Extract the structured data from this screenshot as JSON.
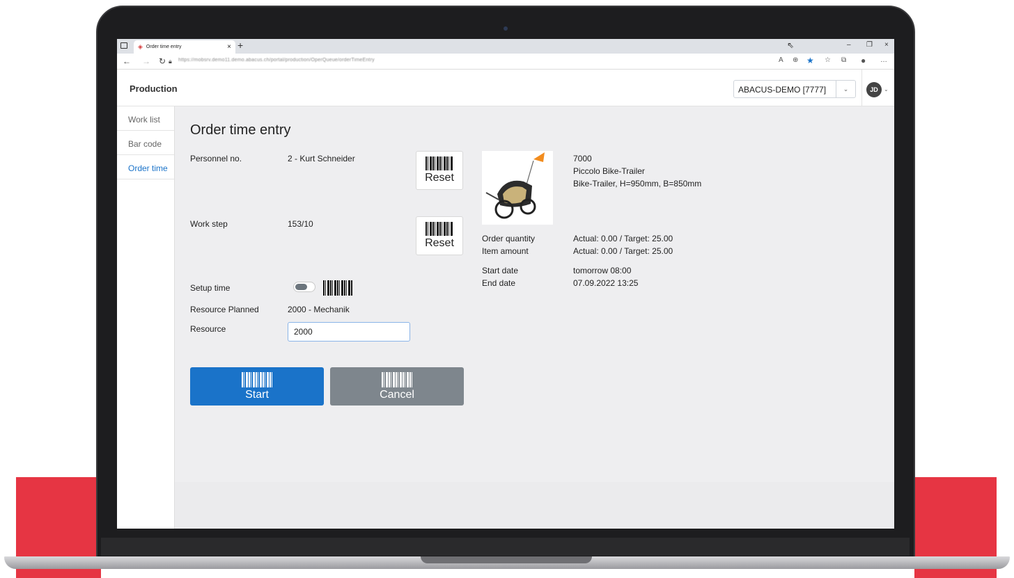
{
  "browser": {
    "tab_title": "Order time entry",
    "tab_close": "×",
    "new_tab": "+",
    "url": "https://mobsrv.demo11.demo.abacus.ch/portal/production/OperQueue/orderTimeEntry",
    "window_controls": {
      "minimize": "–",
      "restore": "❐",
      "close": "×"
    }
  },
  "app": {
    "title": "Production",
    "tenant_selector": "ABACUS-DEMO [7777]",
    "avatar_initials": "JD"
  },
  "sidebar": {
    "items": [
      {
        "label": "Work list"
      },
      {
        "label": "Bar code"
      },
      {
        "label": "Order time"
      }
    ]
  },
  "form": {
    "title": "Order time entry",
    "personnel": {
      "label": "Personnel no.",
      "value": "2 - Kurt Schneider"
    },
    "work_step": {
      "label": "Work step",
      "value": "153/10"
    },
    "reset_label": "Reset",
    "setup_time": {
      "label": "Setup time",
      "enabled": false
    },
    "resource_planned": {
      "label": "Resource Planned",
      "value": "2000 - Mechanik"
    },
    "resource": {
      "label": "Resource",
      "value": "2000"
    },
    "start_label": "Start",
    "cancel_label": "Cancel"
  },
  "item": {
    "number": "7000",
    "name": "Piccolo Bike-Trailer",
    "description": "Bike-Trailer, H=950mm, B=850mm",
    "order_quantity": {
      "label": "Order quantity",
      "value": "Actual: 0.00 / Target: 25.00"
    },
    "item_amount": {
      "label": "Item amount",
      "value": "Actual: 0.00 / Target: 25.00"
    },
    "start_date": {
      "label": "Start date",
      "value": "tomorrow 08:00"
    },
    "end_date": {
      "label": "End date",
      "value": "07.09.2022 13:25"
    }
  },
  "colors": {
    "primary": "#1a73c9",
    "secondary": "#7e868d",
    "accent_red": "#e63543"
  }
}
